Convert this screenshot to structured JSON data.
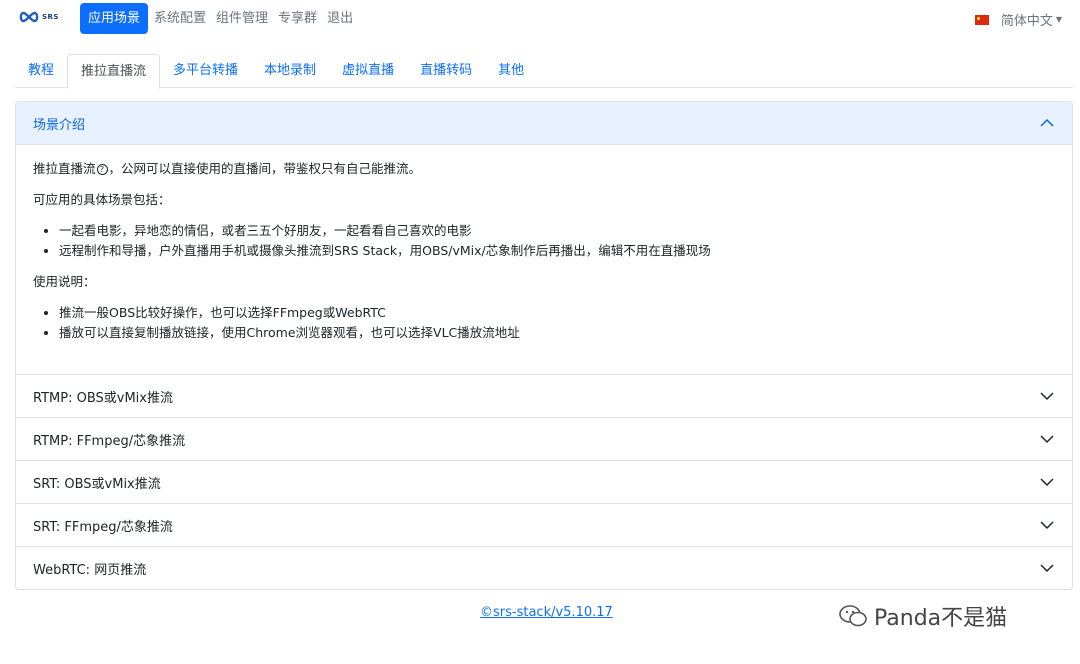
{
  "navbar": {
    "logo_text": "SRS",
    "items": [
      "应用场景",
      "系统配置",
      "组件管理",
      "专享群",
      "退出"
    ],
    "language": "简体中文"
  },
  "tabs": [
    "教程",
    "推拉直播流",
    "多平台转播",
    "本地录制",
    "虚拟直播",
    "直播转码",
    "其他"
  ],
  "accordion": {
    "intro": {
      "title": "场景介绍",
      "line1_a": "推拉直播流",
      "line1_q": "?",
      "line1_b": "，公网可以直接使用的直播间，带鉴权只有自己能推流。",
      "scenes_label": "可应用的具体场景包括：",
      "scenes": [
        "一起看电影，异地恋的情侣，或者三五个好朋友，一起看看自己喜欢的电影",
        "远程制作和导播，户外直播用手机或摄像头推流到SRS Stack，用OBS/vMix/芯象制作后再播出，编辑不用在直播现场"
      ],
      "usage_label": "使用说明：",
      "usage": [
        "推流一般OBS比较好操作，也可以选择FFmpeg或WebRTC",
        "播放可以直接复制播放链接，使用Chrome浏览器观看，也可以选择VLC播放流地址"
      ]
    },
    "sections": [
      "RTMP: OBS或vMix推流",
      "RTMP: FFmpeg/芯象推流",
      "SRT: OBS或vMix推流",
      "SRT: FFmpeg/芯象推流",
      "WebRTC: 网页推流"
    ]
  },
  "footer": {
    "version_link": "©srs-stack/v5.10.17"
  },
  "watermark": {
    "text": "Panda不是猫"
  }
}
